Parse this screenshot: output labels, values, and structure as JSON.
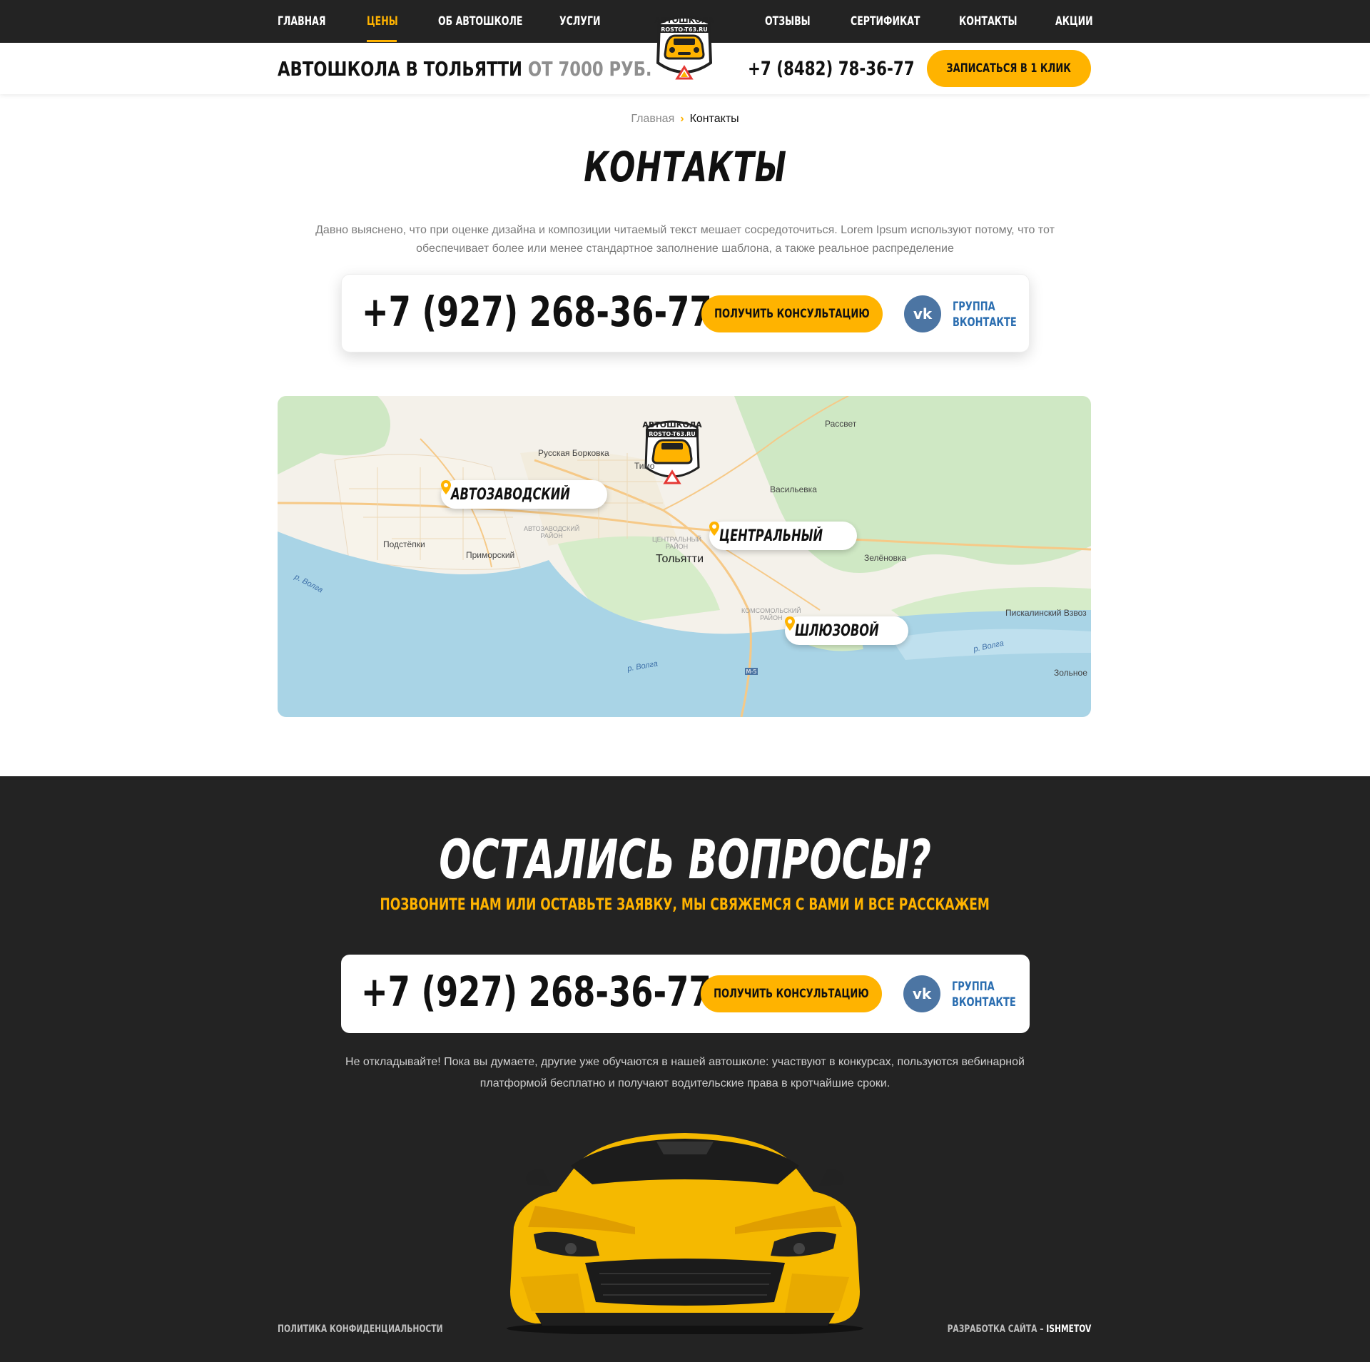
{
  "nav": {
    "items": [
      {
        "label": "ГЛАВНАЯ",
        "active": false
      },
      {
        "label": "ЦЕНЫ",
        "active": true
      },
      {
        "label": "ОБ АВТОШКОЛЕ",
        "active": false
      },
      {
        "label": "УСЛУГИ",
        "active": false
      },
      {
        "label": "ОТЗЫВЫ",
        "active": false
      },
      {
        "label": "СЕРТИФИКАТ",
        "active": false
      },
      {
        "label": "КОНТАКТЫ",
        "active": false
      },
      {
        "label": "АКЦИИ",
        "active": false
      }
    ]
  },
  "logo": {
    "title": "АВТОШКОЛА",
    "domain": "ROSTO-T63.RU"
  },
  "header": {
    "title": "АВТОШКОЛА В ТОЛЬЯТТИ",
    "price": "ОТ 7000 РУБ.",
    "phone": "+7 (8482) 78-36-77",
    "cta": "ЗАПИСАТЬСЯ В 1 КЛИК"
  },
  "breadcrumb": {
    "home": "Главная",
    "separator": "›",
    "current": "Контакты"
  },
  "page": {
    "title": "КОНТАКТЫ",
    "intro": "Давно выяснено, что при оценке дизайна и композиции читаемый текст мешает сосредоточиться. Lorem Ipsum используют потому, что тот обеспечивает более или менее стандартное заполнение шаблона, а также реальное распределение"
  },
  "contact_card": {
    "phone": "+7 (927) 268-36-77",
    "button": "ПОЛУЧИТЬ КОНСУЛЬТАЦИЮ",
    "vk_icon": "vk",
    "vk_line1": "ГРУППА",
    "vk_line2": "ВКОНТАКТЕ"
  },
  "map": {
    "places": [
      "Рассвет",
      "Русская Борковка",
      "Тимо",
      "Васильевка",
      "Подстёпки",
      "Приморский",
      "Тольятти",
      "Зелёновка",
      "Пискалинский Взвоз",
      "Зольное"
    ],
    "districts": [
      "АВТОЗАВОДСКИЙ",
      "РАЙОН",
      "ЦЕНТРАЛЬНЫЙ",
      "РАЙОН",
      "КОМСОМОЛЬСКИЙ",
      "РАЙОН"
    ],
    "rivers": [
      "р. Волга",
      "р. Волга",
      "р. Волга"
    ],
    "road": "M-5",
    "pins": [
      "АВТОЗАВОДСКИЙ",
      "ЦЕНТРАЛЬНЫЙ",
      "ШЛЮЗОВОЙ"
    ],
    "colors": {
      "land": "#f4f1ea",
      "water": "#a9d4e6",
      "green": "#cfe8c4",
      "road": "#f6c987",
      "pin": "#ffb300"
    }
  },
  "questions": {
    "title": "ОСТАЛИСЬ ВОПРОСЫ?",
    "subtitle": "ПОЗВОНИТЕ НАМ ИЛИ ОСТАВЬТЕ ЗАЯВКУ, МЫ СВЯЖЕМСЯ С ВАМИ И ВСЕ РАССКАЖЕМ",
    "text": "Не откладывайте! Пока вы думаете, другие уже обучаются в нашей автошколе: участвуют в конкурсах, пользуются вебинарной платформой бесплатно и получают водительские права в кротчайшие сроки."
  },
  "footer": {
    "privacy": "ПОЛИТИКА КОНФИДЕНЦИАЛЬНОСТИ",
    "dev_prefix": "РАЗРАБОТКА САЙТА –",
    "dev_name": "ISHMETOV"
  },
  "colors": {
    "accent": "#ffb300",
    "dark": "#232323",
    "vk": "#4c75a3",
    "vk_text": "#2a6db0"
  }
}
